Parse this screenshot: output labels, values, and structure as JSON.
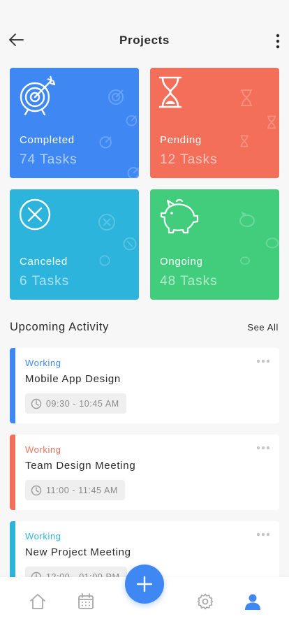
{
  "header": {
    "title": "Projects"
  },
  "stats": [
    {
      "label": "Completed",
      "count": "74 Tasks",
      "color": "#3f88f4",
      "icon": "target-arrow-icon"
    },
    {
      "label": "Pending",
      "count": "12 Tasks",
      "color": "#f36f5a",
      "icon": "hourglass-icon"
    },
    {
      "label": "Canceled",
      "count": "6 Tasks",
      "color": "#2cb4dc",
      "icon": "cancel-circle-icon"
    },
    {
      "label": "Ongoing",
      "count": "48 Tasks",
      "color": "#42cd7c",
      "icon": "piggy-bank-icon"
    }
  ],
  "activity": {
    "title": "Upcoming Activity",
    "see_all": "See All",
    "items": [
      {
        "status": "Working",
        "title": "Mobile App Design",
        "time": "09:30 - 10:45 AM",
        "color": "#3f88f4"
      },
      {
        "status": "Working",
        "title": "Team Design Meeting",
        "time": "11:00 - 11:45 AM",
        "color": "#f36f5a"
      },
      {
        "status": "Working",
        "title": "New Project Meeting",
        "time": "12:00 - 01:00 PM",
        "color": "#2cb4dc"
      }
    ]
  },
  "nav": {
    "items": [
      "home-icon",
      "calendar-icon",
      "add-icon",
      "settings-icon",
      "profile-icon"
    ],
    "active": "profile-icon",
    "accent": "#3f88f4"
  }
}
